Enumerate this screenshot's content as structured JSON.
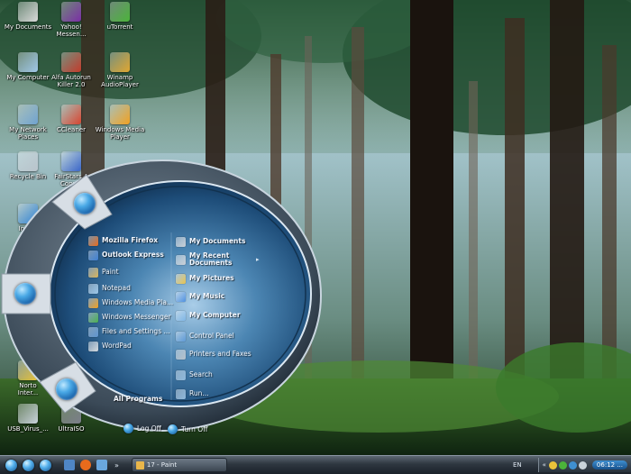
{
  "desktop_icons": [
    {
      "id": "my-documents",
      "label": "My Documents",
      "icon": "folder-documents-icon",
      "color": "#d9d9d9"
    },
    {
      "id": "yahoo-messenger",
      "label": "Yahoo!\nMessen...",
      "icon": "yahoo-messenger-icon",
      "color": "#7b2ea6"
    },
    {
      "id": "utorrent",
      "label": "uTorrent",
      "icon": "utorrent-icon",
      "color": "#4bb33a"
    },
    {
      "id": "my-computer",
      "label": "My Computer",
      "icon": "computer-icon",
      "color": "#9fc7e8"
    },
    {
      "id": "alfa-autorun-killer",
      "label": "Alfa Autorun\nKiller 2.0",
      "icon": "alfa-autorun-killer-icon",
      "color": "#c33b2b"
    },
    {
      "id": "winamp",
      "label": "Winamp\nAudioPlayer",
      "icon": "winamp-icon",
      "color": "#e0a630"
    },
    {
      "id": "my-network-places",
      "label": "My Network\nPlaces",
      "icon": "network-places-icon",
      "color": "#6fa2d0"
    },
    {
      "id": "ccleaner",
      "label": "CCleaner",
      "icon": "ccleaner-icon",
      "color": "#d7442f"
    },
    {
      "id": "windows-media-player",
      "label": "Windows Media\nPlayer",
      "icon": "media-player-icon",
      "color": "#f0a020"
    },
    {
      "id": "recycle-bin",
      "label": "Recycle Bin",
      "icon": "recycle-bin-icon",
      "color": "#b9c4cc"
    },
    {
      "id": "fairstars",
      "label": "FairStars A\nConv...",
      "icon": "fairstars-icon",
      "color": "#3a66c9"
    },
    {
      "id": "internet-explorer",
      "label": "Intern\nExpl",
      "icon": "internet-explorer-icon",
      "color": "#2f83d6"
    },
    {
      "id": "norton",
      "label": "Norto\nInter...",
      "icon": "norton-icon",
      "color": "#e9c23a"
    },
    {
      "id": "usb-virus",
      "label": "USB_Virus_...",
      "icon": "usb-virus-icon",
      "color": "#c9d3db"
    },
    {
      "id": "ultraiso",
      "label": "UltraISO",
      "icon": "ultraiso-icon",
      "color": "#7c7f8b"
    }
  ],
  "start_menu": {
    "left_items": [
      {
        "label": "Mozilla Firefox",
        "icon": "firefox-icon",
        "color": "#e86b1c",
        "bold": true
      },
      {
        "label": "Outlook Express",
        "icon": "outlook-express-icon",
        "color": "#3f7fd3",
        "bold": true
      },
      {
        "label": "Paint",
        "icon": "paint-icon",
        "color": "#d8b35b",
        "bold": false
      },
      {
        "label": "Notepad",
        "icon": "notepad-icon",
        "color": "#9bc6e8",
        "bold": false
      },
      {
        "label": "Windows Media Pla...",
        "icon": "media-player-icon",
        "color": "#f0a020",
        "bold": false
      },
      {
        "label": "Windows Messenger",
        "icon": "messenger-icon",
        "color": "#4caf50",
        "bold": false
      },
      {
        "label": "Files and Settings ...",
        "icon": "files-settings-icon",
        "color": "#5e95cf",
        "bold": false
      },
      {
        "label": "WordPad",
        "icon": "wordpad-icon",
        "color": "#d6dbe0",
        "bold": false
      }
    ],
    "all_programs": "All Programs",
    "right_items": [
      {
        "label": "My Documents",
        "icon": "my-documents-icon",
        "color": "#c9cfd6",
        "bold": true
      },
      {
        "label": "My Recent",
        "label2": "Documents",
        "icon": "recent-documents-icon",
        "color": "#c9cfd6",
        "bold": true
      },
      {
        "label": "My Pictures",
        "icon": "my-pictures-icon",
        "color": "#e7c24d",
        "bold": true
      },
      {
        "label": "My Music",
        "icon": "my-music-icon",
        "color": "#4d8fe0",
        "bold": true
      },
      {
        "label": "My Computer",
        "icon": "my-computer-icon",
        "color": "#7fb6e6",
        "bold": true
      },
      {
        "label": "Control Panel",
        "icon": "control-panel-icon",
        "color": "#5f9bd8",
        "bold": false
      },
      {
        "label": "Printers and Faxes",
        "icon": "printers-icon",
        "color": "#b7c2cc",
        "bold": false
      },
      {
        "label": "Search",
        "icon": "search-icon",
        "color": "#8fb9dc",
        "bold": false
      },
      {
        "label": "Run...",
        "icon": "run-icon",
        "color": "#8fb9dc",
        "bold": false
      }
    ],
    "log_off": "Log Off",
    "turn_off": "Turn Off"
  },
  "taskbar": {
    "task_label": "17 - Paint",
    "language": "EN",
    "clock": "06:12 ..."
  },
  "colors": {
    "orb_ring": "#3b4a58",
    "orb_glass": "#2a5f8a",
    "accent_blue": "#2f8fd8"
  }
}
